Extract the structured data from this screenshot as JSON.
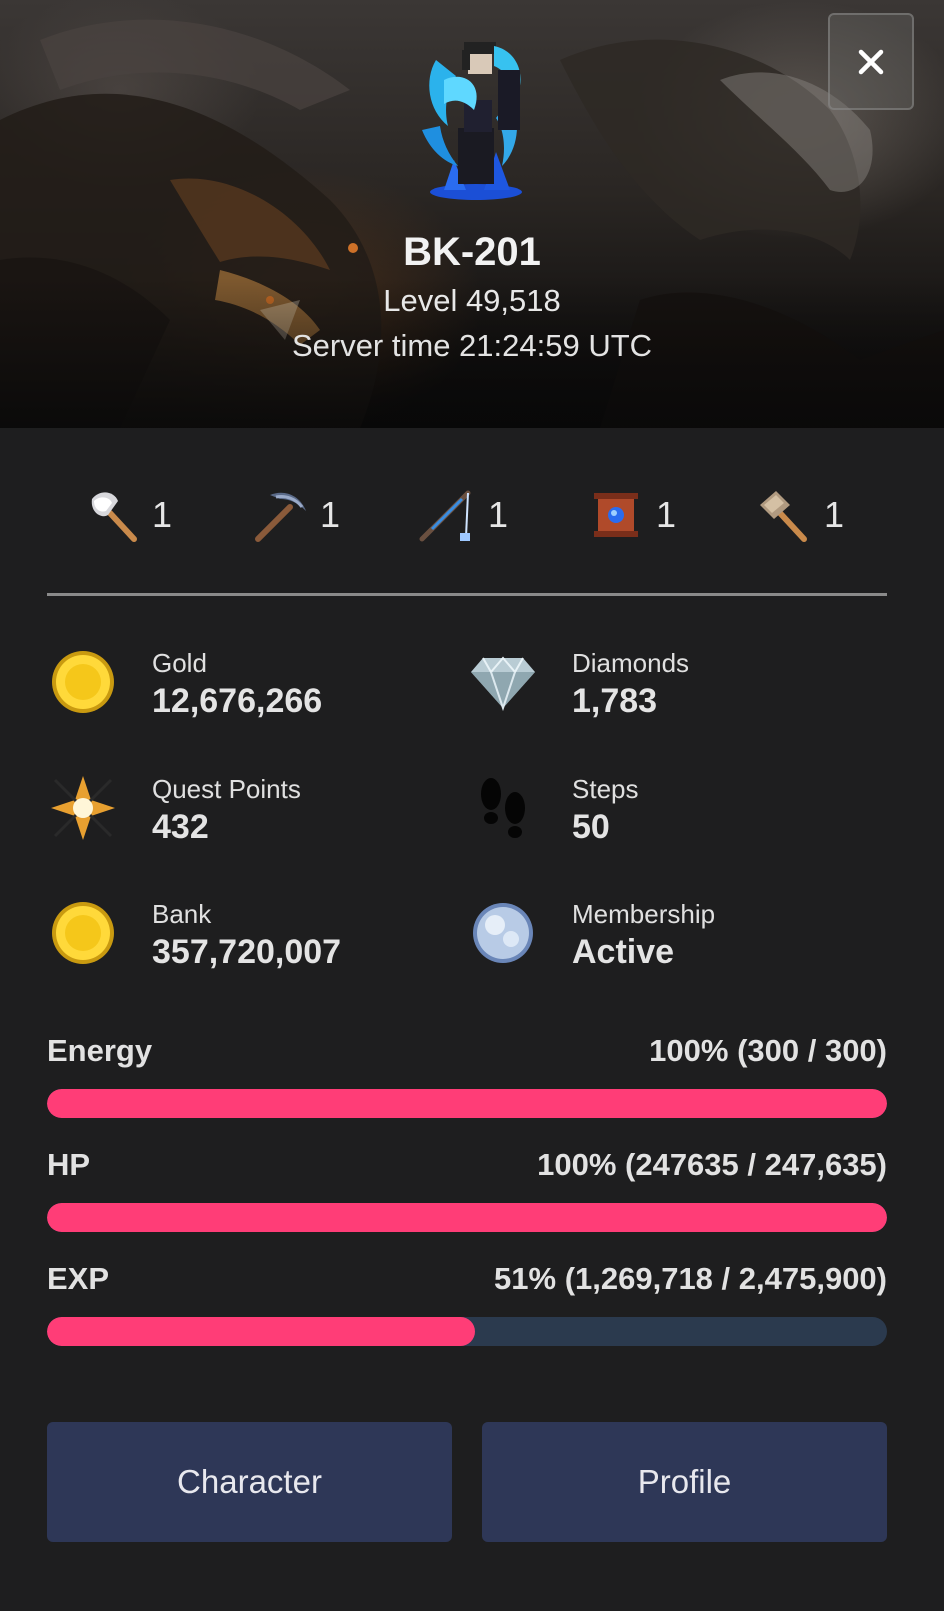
{
  "header": {
    "character_name": "BK-201",
    "level_text": "Level 49,518",
    "server_time_text": "Server time 21:24:59 UTC",
    "close_icon": "close-icon"
  },
  "tools": [
    {
      "icon": "axe-icon",
      "count": "1"
    },
    {
      "icon": "pickaxe-icon",
      "count": "1"
    },
    {
      "icon": "fishing-rod-icon",
      "count": "1"
    },
    {
      "icon": "scroll-icon",
      "count": "1"
    },
    {
      "icon": "hammer-icon",
      "count": "1"
    }
  ],
  "stats": {
    "gold": {
      "label": "Gold",
      "value": "12,676,266",
      "icon": "gold-coin-icon"
    },
    "diamonds": {
      "label": "Diamonds",
      "value": "1,783",
      "icon": "diamond-icon"
    },
    "quest_points": {
      "label": "Quest Points",
      "value": "432",
      "icon": "quest-star-icon"
    },
    "steps": {
      "label": "Steps",
      "value": "50",
      "icon": "footprints-icon"
    },
    "bank": {
      "label": "Bank",
      "value": "357,720,007",
      "icon": "bank-coin-icon"
    },
    "membership": {
      "label": "Membership",
      "value": "Active",
      "icon": "membership-orb-icon"
    }
  },
  "bars": {
    "energy": {
      "label": "Energy",
      "value_text": "100% (300 / 300)",
      "percent": 100
    },
    "hp": {
      "label": "HP",
      "value_text": "100% (247635 / 247,635)",
      "percent": 100
    },
    "exp": {
      "label": "EXP",
      "value_text": "51% (1,269,718 / 2,475,900)",
      "percent": 51
    }
  },
  "buttons": {
    "character_label": "Character",
    "profile_label": "Profile"
  },
  "colors": {
    "background": "#1e1e1f",
    "bar_fill": "#ff3d77",
    "bar_track": "#2b3a4e",
    "button": "#2e3757"
  }
}
